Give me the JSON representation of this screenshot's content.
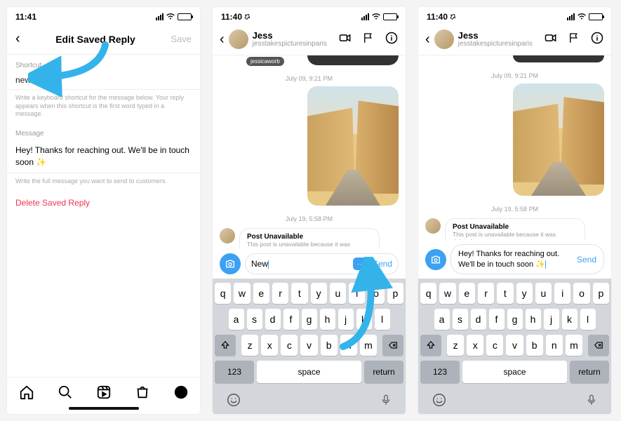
{
  "screen1": {
    "time": "11:41",
    "header_title": "Edit Saved Reply",
    "header_save": "Save",
    "shortcut_label": "Shortcut",
    "shortcut_value": "new",
    "shortcut_help": "Write a keyboard shortcut for the message below. Your reply appears when this shortcut is the first word typed in a message.",
    "message_label": "Message",
    "message_value": "Hey! Thanks for reaching out. We'll be in touch soon ✨",
    "message_help": "Write the full message you want to send to customers.",
    "delete_label": "Delete Saved Reply"
  },
  "screen2": {
    "time": "11:40",
    "name": "Jess",
    "username": "jesstakespicturesinparis",
    "prev_user_tag": "jessicaworb",
    "date1": "July 09, 9:21 PM",
    "date2": "July 19, 5:58 PM",
    "unavail_title": "Post Unavailable",
    "unavail_body": "This post is unavailable because it was deleted.",
    "input_text": "New",
    "send": "Send"
  },
  "screen3": {
    "time": "11:40",
    "name": "Jess",
    "username": "jesstakespicturesinparis",
    "date1": "July 09, 9:21 PM",
    "date2": "July 19, 5:58 PM",
    "unavail_title": "Post Unavailable",
    "unavail_body": "This post is unavailable because it was deleted.",
    "input_text": "Hey! Thanks for reaching out. We'll be in touch soon ✨",
    "send": "Send"
  },
  "keyboard": {
    "row1": [
      "q",
      "w",
      "e",
      "r",
      "t",
      "y",
      "u",
      "i",
      "o",
      "p"
    ],
    "row2": [
      "a",
      "s",
      "d",
      "f",
      "g",
      "h",
      "j",
      "k",
      "l"
    ],
    "row3": [
      "z",
      "x",
      "c",
      "v",
      "b",
      "n",
      "m"
    ],
    "k123": "123",
    "space": "space",
    "return": "return"
  }
}
